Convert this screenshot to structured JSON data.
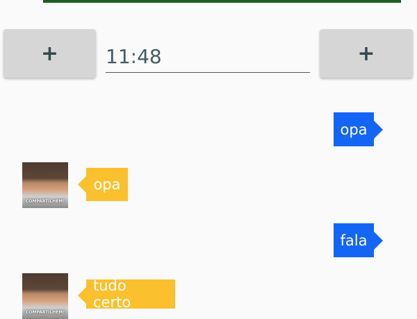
{
  "toolbar": {
    "left_button_label": "+",
    "right_button_label": "+",
    "time_value": "11:48"
  },
  "messages": [
    {
      "side": "right",
      "text": "opa",
      "color": "#1565f5"
    },
    {
      "side": "left",
      "text": "opa",
      "color": "#fbc02d",
      "avatar_icon": "user-avatar-icon",
      "avatar_caption": "COMPARTILHEM!"
    },
    {
      "side": "right",
      "text": "fala",
      "color": "#1565f5"
    },
    {
      "side": "left",
      "text": "tudo certo",
      "color": "#fbc02d",
      "avatar_icon": "user-avatar-icon",
      "avatar_caption": "COMPARTILHEM!"
    }
  ],
  "colors": {
    "top_bar": "#1b5e20",
    "button_bg": "#d6d6d6",
    "sent_bubble": "#1565f5",
    "received_bubble": "#fbc02d"
  }
}
